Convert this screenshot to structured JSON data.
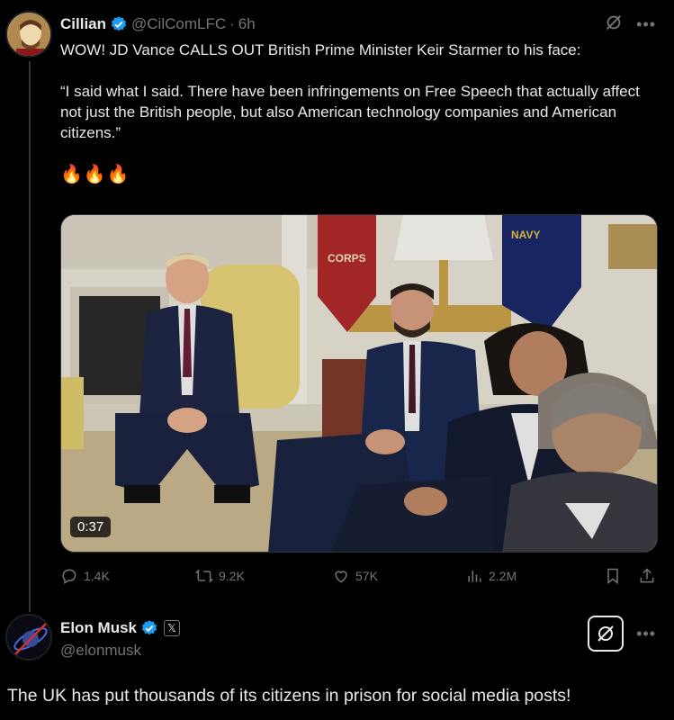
{
  "tweet": {
    "author_name": "Cillian",
    "author_handle": "@CilComLFC",
    "separator": "·",
    "time": "6h",
    "line1": "WOW! JD Vance CALLS OUT British Prime Minister Keir Starmer to his face:",
    "quote": "“I said what I said. There have been infringements on Free Speech that actually affect not just the British people, but also American technology companies and American citizens.”",
    "emojis": "🔥🔥🔥",
    "media": {
      "duration": "0:37",
      "flag1_text": "CORPS",
      "flag2_text": "NAVY"
    },
    "actions": {
      "replies": "1.4K",
      "retweets": "9.2K",
      "likes": "57K",
      "views": "2.2M"
    },
    "icons": [
      "verified-badge-icon",
      "grok-icon",
      "more-icon",
      "reply-icon",
      "retweet-icon",
      "like-icon",
      "views-icon",
      "bookmark-icon",
      "share-icon"
    ]
  },
  "reply": {
    "author_name": "Elon Musk",
    "author_handle": "@elonmusk",
    "badge": "𝕏",
    "text": "The UK has put thousands of its citizens in prison for social media posts!"
  },
  "colors": {
    "background": "#000000",
    "text": "#e7e9ea",
    "muted": "#71767b",
    "verified": "#1d9bf0"
  }
}
